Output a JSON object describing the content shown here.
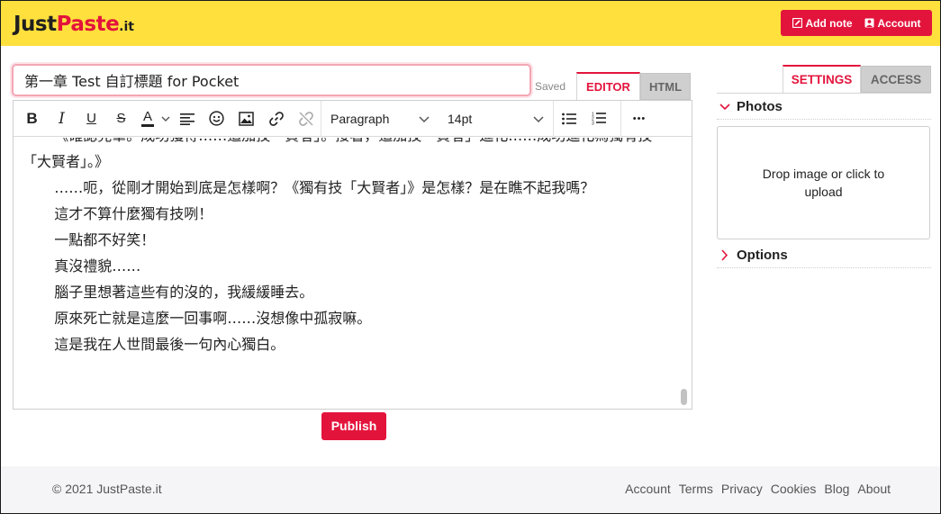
{
  "header": {
    "logo_part1": "Just",
    "logo_part2": "Paste",
    "logo_part3": ".it",
    "add_note_label": "Add note",
    "account_label": "Account"
  },
  "editor": {
    "title_value": "第一章 Test 自訂標題 for Pocket",
    "saved_label": "Saved",
    "tab_editor": "EDITOR",
    "tab_html": "HTML",
    "toolbar": {
      "bold": "B",
      "italic": "I",
      "underline": "U",
      "strike": "S",
      "text_color": "A",
      "block_format": "Paragraph",
      "font_size": "14pt",
      "more": "•••"
    },
    "paragraphs": [
      "《確認完畢。成功獲得……追加技「賢者」。接著，追加技「賢者」進化……成功進化為獨有技「大賢者」。》",
      "……呃，從剛才開始到底是怎樣啊？《獨有技「大賢者」》是怎樣？是在瞧不起我嗎？",
      "這才不算什麼獨有技咧！",
      "一點都不好笑！",
      "真沒禮貌……",
      "腦子里想著這些有的沒的，我緩緩睡去。",
      "原來死亡就是這麼一回事啊……沒想像中孤寂嘛。",
      "這是我在人世間最後一句內心獨白。"
    ],
    "publish_label": "Publish"
  },
  "sidebar": {
    "tab_settings": "SETTINGS",
    "tab_access": "ACCESS",
    "photos_label": "Photos",
    "dropzone_text": "Drop image or click to upload",
    "options_label": "Options"
  },
  "footer": {
    "copyright": "© 2021 JustPaste.it",
    "links": [
      "Account",
      "Terms",
      "Privacy",
      "Cookies",
      "Blog",
      "About"
    ]
  },
  "colors": {
    "brand_yellow": "#ffe03d",
    "accent_red": "#e3143c"
  }
}
